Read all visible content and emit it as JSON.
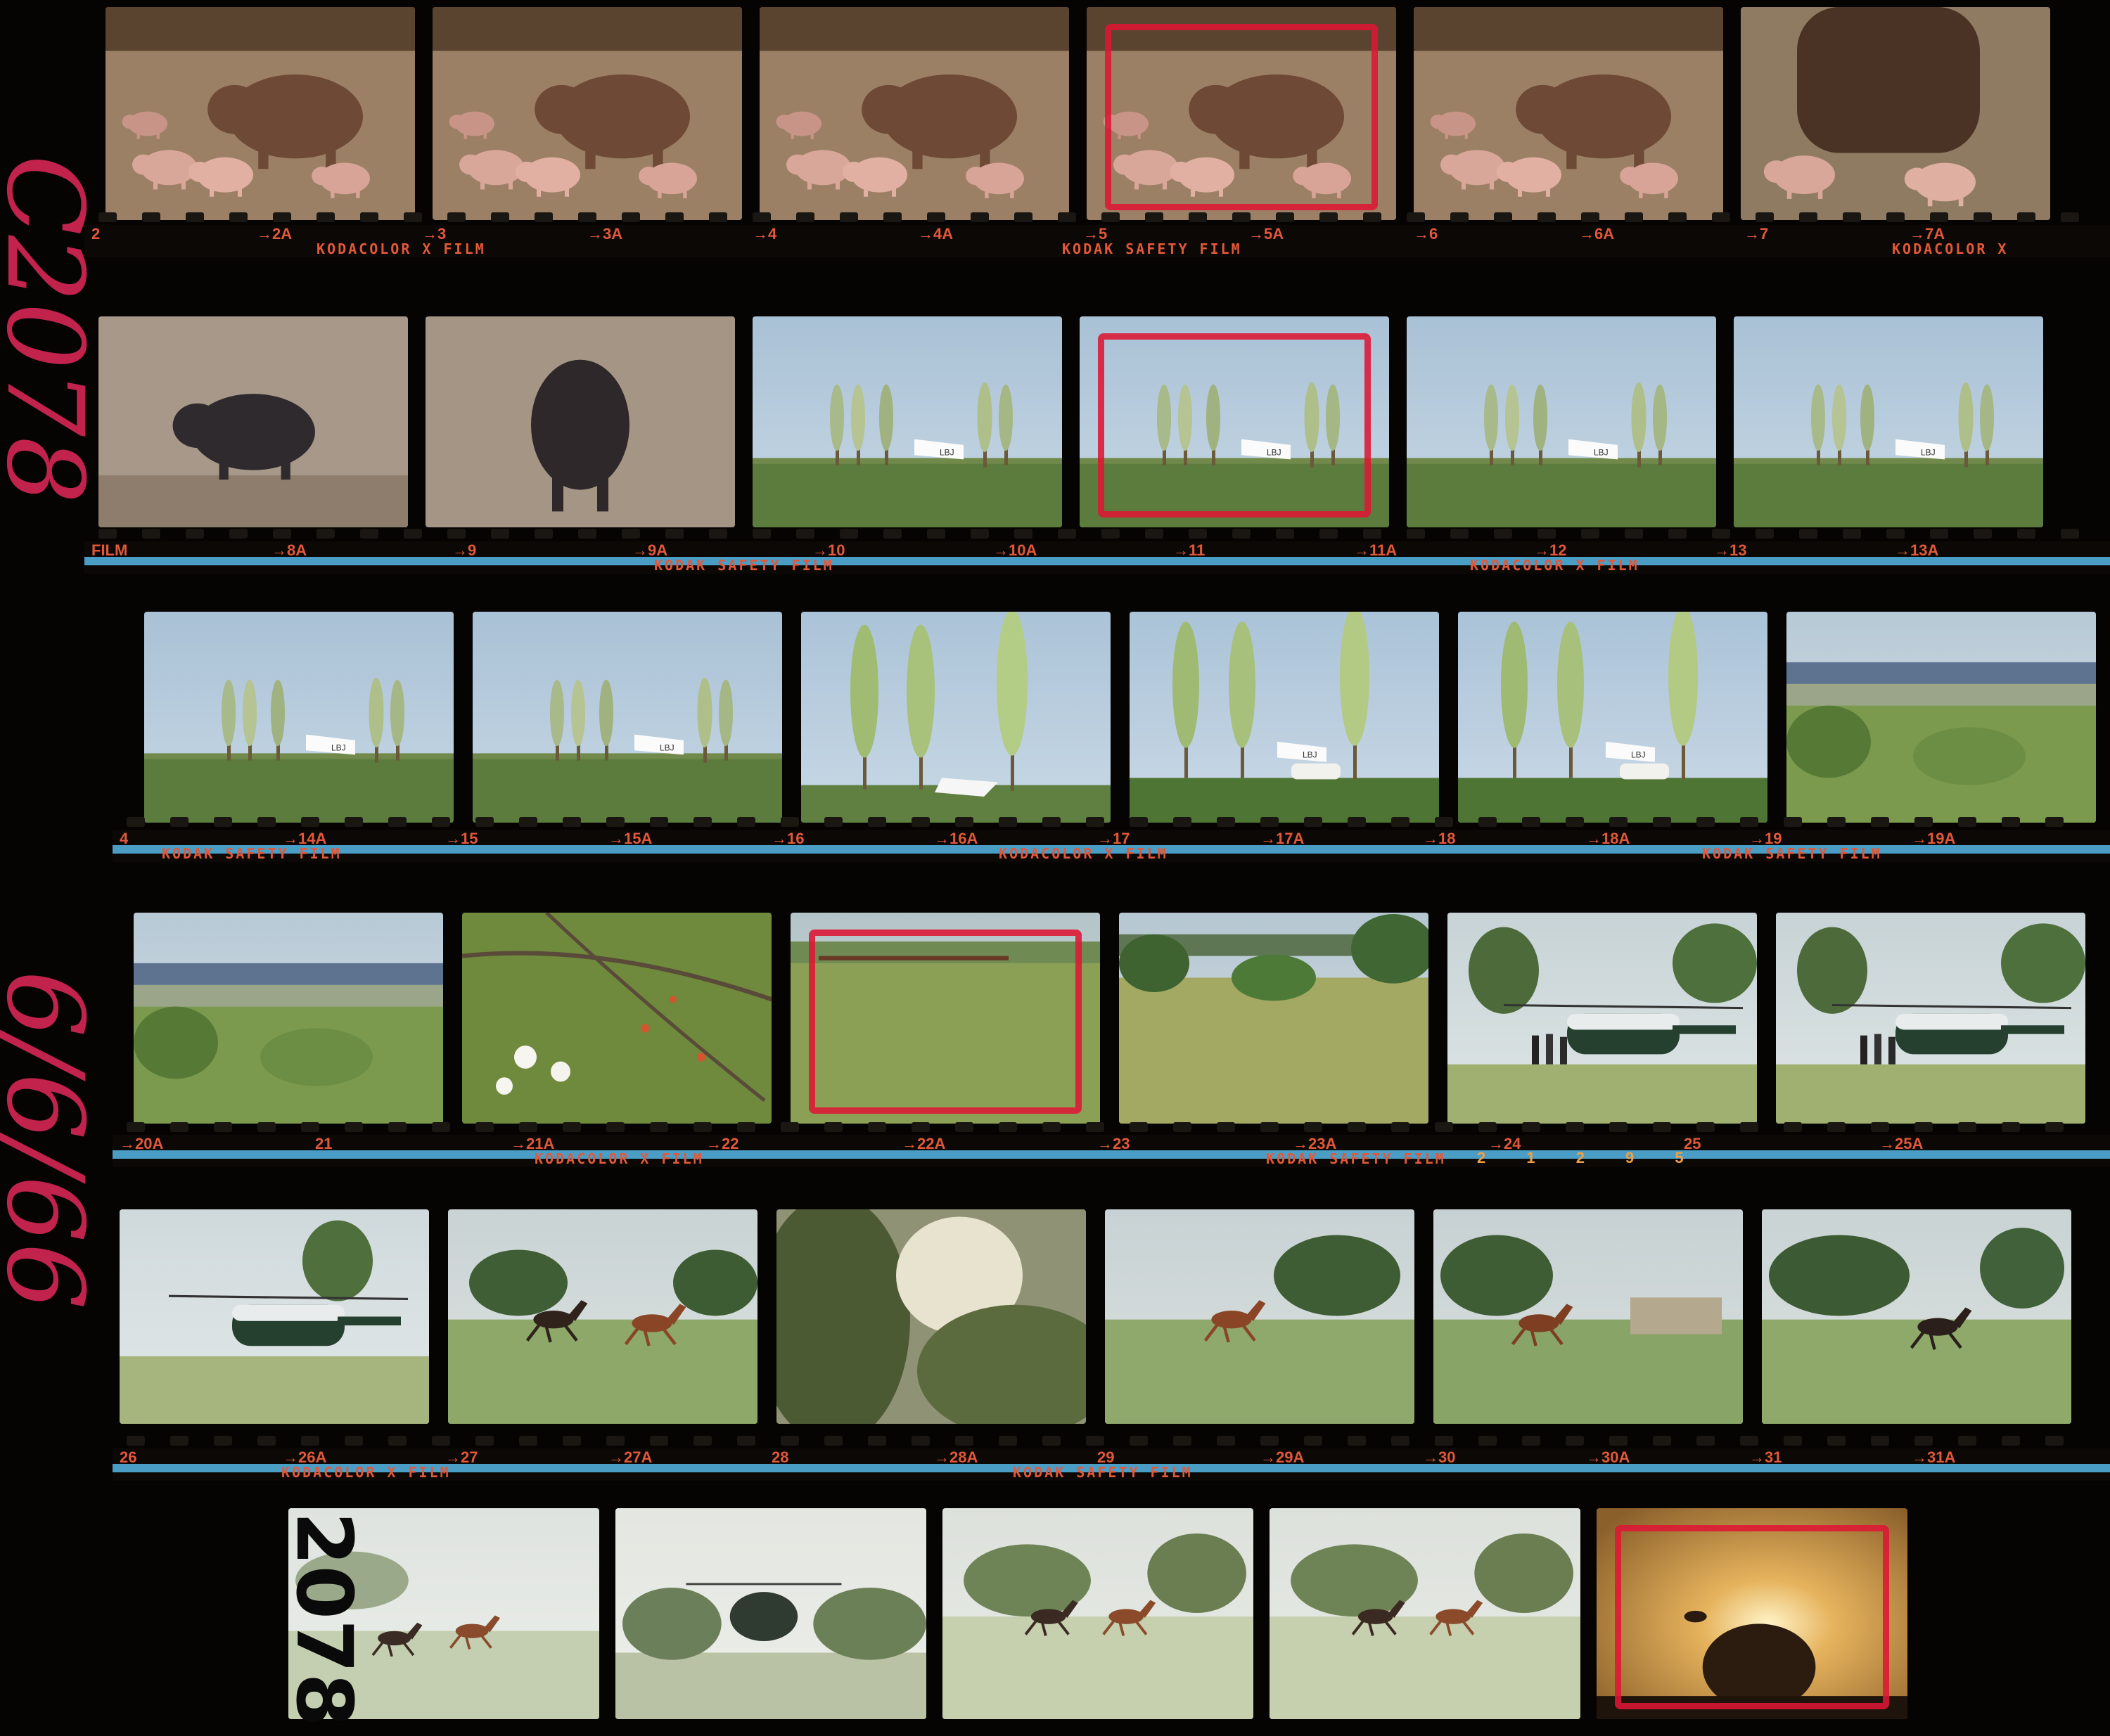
{
  "sheet": {
    "roll_number": "2078",
    "handwritten_roll": "C2078",
    "handwritten_date": "6/6/66",
    "edge_marks": [
      "2 1 2 9 5"
    ]
  },
  "film_labels": {
    "kodacolor": "KODACOLOR X FILM",
    "kodak_safety": "KODAK SAFETY FILM"
  },
  "rows": [
    {
      "frames": [
        {
          "subject": "sow-piglets"
        },
        {
          "subject": "sow-piglets"
        },
        {
          "subject": "sow-piglets"
        },
        {
          "subject": "sow-piglets",
          "marked": true
        },
        {
          "subject": "sow-piglets"
        },
        {
          "subject": "sow-piglets-dark"
        }
      ],
      "edge_numbers": [
        "2",
        "→2A",
        "→3",
        "→3A",
        "→4",
        "→4A",
        "→5",
        "→5A",
        "→6",
        "→6A",
        "→7",
        "→7A"
      ],
      "edge_labels": [
        "KODACOLOR X FILM",
        "KODAK SAFETY FILM",
        "KODACOLOR X"
      ]
    },
    {
      "frames": [
        {
          "subject": "black-hog"
        },
        {
          "subject": "black-hog-front"
        },
        {
          "subject": "lbj-field"
        },
        {
          "subject": "lbj-field",
          "marked": true
        },
        {
          "subject": "lbj-field"
        },
        {
          "subject": "lbj-field"
        }
      ],
      "edge_numbers": [
        "FILM",
        "→8A",
        "→9",
        "→9A",
        "→10",
        "→10A",
        "→11",
        "→11A",
        "→12",
        "→13",
        "→13A"
      ],
      "edge_labels": [
        "KODAK SAFETY FILM",
        "KODACOLOR X FILM"
      ]
    },
    {
      "frames": [
        {
          "subject": "lbj-field"
        },
        {
          "subject": "lbj-field"
        },
        {
          "subject": "lbj-trees-close"
        },
        {
          "subject": "lbj-car"
        },
        {
          "subject": "lbj-car"
        },
        {
          "subject": "hill-country"
        }
      ],
      "edge_numbers": [
        "4",
        "→14A",
        "→15",
        "→15A",
        "→16",
        "→16A",
        "→17",
        "→17A",
        "→18",
        "→18A",
        "→19",
        "→19A"
      ],
      "edge_labels": [
        "KODAK SAFETY FILM",
        "KODACOLOR X FILM",
        "KODAK SAFETY FILM"
      ]
    },
    {
      "frames": [
        {
          "subject": "hill-country"
        },
        {
          "subject": "wildflowers"
        },
        {
          "subject": "cattle-pasture",
          "marked": true
        },
        {
          "subject": "pasture-trees"
        },
        {
          "subject": "helicopter-group"
        },
        {
          "subject": "helicopter-group"
        }
      ],
      "edge_numbers": [
        "→20A",
        "21",
        "→21A",
        "→22",
        "→22A",
        "→23",
        "→23A",
        "→24",
        "25",
        "→25A"
      ],
      "edge_labels": [
        "KODACOLOR X FILM",
        "KODAK SAFETY FILM"
      ]
    },
    {
      "frames": [
        {
          "subject": "helicopter-side"
        },
        {
          "subject": "horses-running"
        },
        {
          "subject": "blur"
        },
        {
          "subject": "horse-single"
        },
        {
          "subject": "horse-barn"
        },
        {
          "subject": "horse-dark"
        }
      ],
      "edge_numbers": [
        "26",
        "→26A",
        "→27",
        "→27A",
        "28",
        "→28A",
        "29",
        "→29A",
        "→30",
        "→30A",
        "→31",
        "→31A"
      ],
      "edge_labels": [
        "KODACOLOR X FILM",
        "KODAK SAFETY FILM"
      ]
    },
    {
      "frames": [
        {
          "subject": "horses-faint"
        },
        {
          "subject": "helicopter-landing"
        },
        {
          "subject": "horses-pair"
        },
        {
          "subject": "horses-pair"
        },
        {
          "subject": "sunset-helicopter",
          "marked": true
        }
      ],
      "edge_numbers": [],
      "edge_labels": []
    }
  ],
  "colors": {
    "edge_print": "#e2583a",
    "grease_pencil": "#de1634",
    "leader_stripe": "#4a9ec6"
  }
}
